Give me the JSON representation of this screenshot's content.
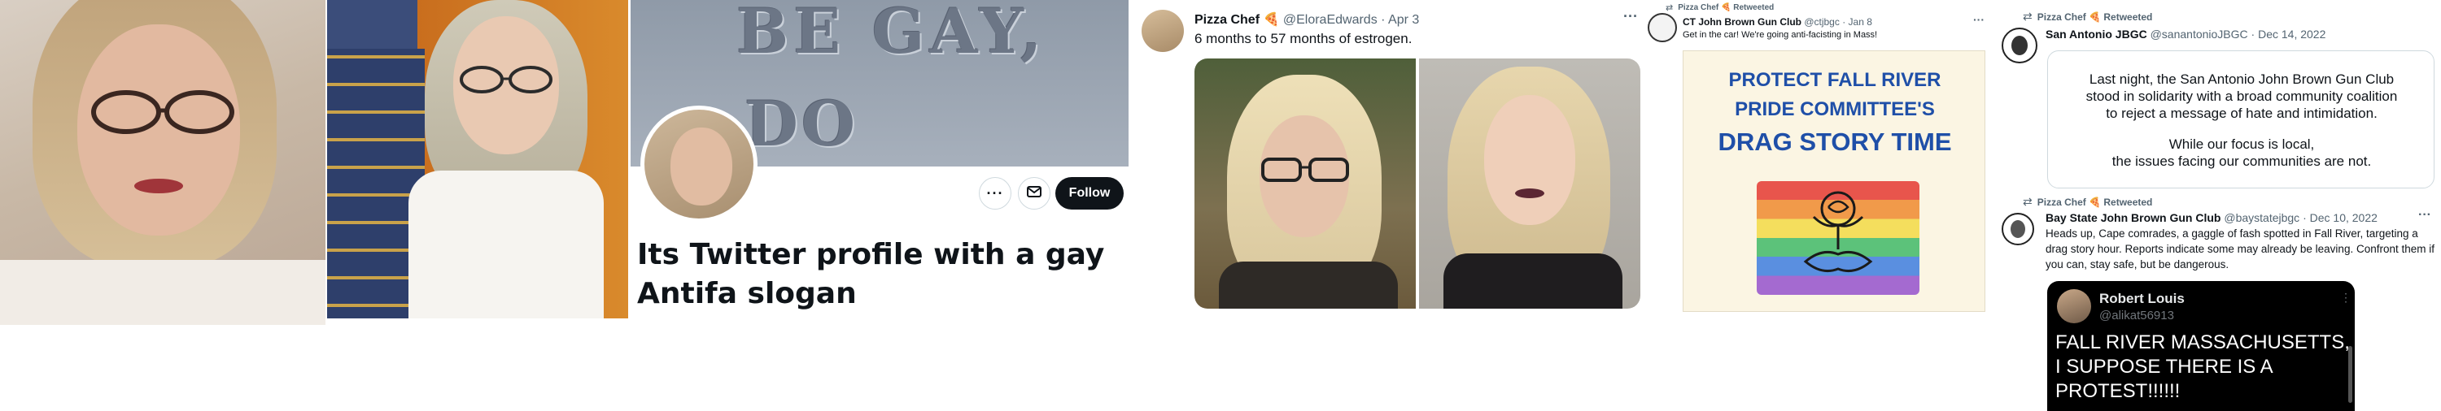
{
  "panel_profile": {
    "banner_text_line1": "BE GAY,",
    "banner_text_line2": "DO CRIMES",
    "more_icon": "more-horizontal-icon",
    "mail_icon": "envelope-icon",
    "follow_label": "Follow",
    "caption": "Its Twitter profile with a gay Antifa slogan"
  },
  "tweet_pizza": {
    "display_name": "Pizza Chef",
    "emoji": "🍕",
    "handle": "@EloraEdwards",
    "date": "· Apr 3",
    "text": "6 months to 57 months of estrogen.",
    "more_icon": "more-horizontal-icon"
  },
  "tweet_ct": {
    "retweeted_by": "Pizza Chef 🍕 Retweeted",
    "display_name": "CT John Brown Gun Club",
    "handle": "@ctjbgc",
    "date": "· Jan 8",
    "text": "Get in the car! We're going anti-facisting in Mass!",
    "poster_line1": "PROTECT FALL RIVER",
    "poster_line2": "PRIDE COMMITTEE'S",
    "poster_line3": "DRAG STORY TIME",
    "more_icon": "more-horizontal-icon"
  },
  "tweet_sa": {
    "retweeted_by": "Pizza Chef 🍕 Retweeted",
    "display_name": "San Antonio JBGC",
    "handle": "@sanantonioJBGC",
    "date": "· Dec 14, 2022",
    "statement_line1": "Last night, the San Antonio John Brown Gun Club",
    "statement_line2": "stood in solidarity with a broad community coalition",
    "statement_line3": "to reject a message of hate and intimidation.",
    "statement_line4": "While our focus is local,",
    "statement_line5": "the issues facing our communities are not."
  },
  "tweet_bay": {
    "retweeted_by": "Pizza Chef 🍕 Retweeted",
    "display_name": "Bay State John Brown Gun Club",
    "handle": "@baystatejbgc",
    "date": "· Dec 10, 2022",
    "text": "Heads up, Cape comrades, a gaggle of fash spotted in Fall River, targeting a drag story hour. Reports indicate some may already be leaving. Confront them if you can, stay safe, but be dangerous.",
    "more_icon": "more-horizontal-icon",
    "embed": {
      "display_name": "Robert Louis",
      "handle": "@alikat56913",
      "line1": "FALL RIVER MASSACHUSETTS,",
      "line2": "I SUPPOSE THERE IS A",
      "line3": "PROTEST!!!!!!"
    }
  },
  "colors": {
    "twitter_text": "#0f1419",
    "twitter_muted": "#536471",
    "follow_button": "#0f1419",
    "poster_blue": "#1f4fa8",
    "poster_background": "#fbf5e3"
  }
}
